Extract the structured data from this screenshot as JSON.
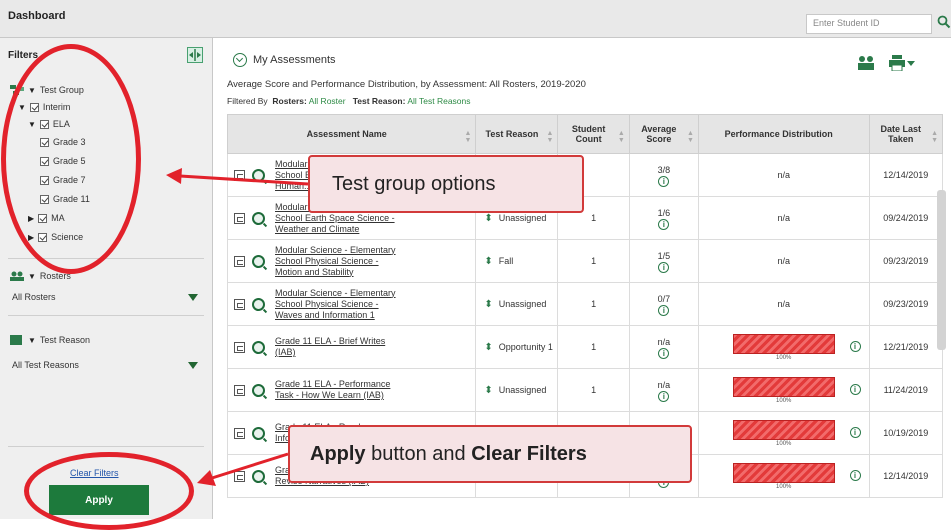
{
  "header": {
    "title": "Dashboard",
    "student_placeholder": "Enter Student ID"
  },
  "sidebar": {
    "filters_label": "Filters",
    "test_group_label": "Test Group",
    "tree": [
      {
        "label": "Interim",
        "level": 1,
        "expanded": true
      },
      {
        "label": "ELA",
        "level": 2,
        "expanded": true
      },
      {
        "label": "Grade 3",
        "level": 3
      },
      {
        "label": "Grade 5",
        "level": 3
      },
      {
        "label": "Grade 7",
        "level": 3
      },
      {
        "label": "Grade 11",
        "level": 3
      },
      {
        "label": "MA",
        "level": 2,
        "expanded": false
      },
      {
        "label": "Science",
        "level": 2,
        "expanded": false
      }
    ],
    "rosters_label": "Rosters",
    "rosters_value": "All Rosters",
    "test_reason_label": "Test Reason",
    "test_reason_value": "All Test Reasons",
    "clear_filters": "Clear Filters",
    "apply": "Apply"
  },
  "main": {
    "section_title": "My Assessments",
    "subtitle": "Average Score and Performance Distribution, by Assessment: All Rosters, 2019-2020",
    "filtered_by_prefix": "Filtered By",
    "rosters_key": "Rosters:",
    "rosters_val": "All Roster",
    "reason_key": "Test Reason:",
    "reason_val": "All Test Reasons"
  },
  "table": {
    "columns": [
      "Assessment Name",
      "Test Reason",
      "Student Count",
      "Average Score",
      "Performance Distribution",
      "Date Last Taken"
    ],
    "rows": [
      {
        "name": "Modular Science - Elementary School Earth Space Science - Human...",
        "reason": "",
        "count": "",
        "score": "3/8",
        "perf": "n/a",
        "date": "12/14/2019"
      },
      {
        "name": "Modular Science - Elementary School Earth Space Science - Weather and Climate",
        "reason": "Unassigned",
        "count": "1",
        "score": "1/6",
        "perf": "n/a",
        "date": "09/24/2019"
      },
      {
        "name": "Modular Science - Elementary School Physical Science - Motion and Stability",
        "reason": "Fall",
        "count": "1",
        "score": "1/5",
        "perf": "n/a",
        "date": "09/23/2019"
      },
      {
        "name": "Modular Science - Elementary School Physical Science - Waves and Information 1",
        "reason": "Unassigned",
        "count": "1",
        "score": "0/7",
        "perf": "n/a",
        "date": "09/23/2019"
      },
      {
        "name": "Grade 11 ELA - Brief Writes (IAB)",
        "reason": "Opportunity 1",
        "count": "1",
        "score": "n/a",
        "perf_pct": 100,
        "pct_label": "100%",
        "date": "12/21/2019"
      },
      {
        "name": "Grade 11 ELA - Performance Task - How We Learn (IAB)",
        "reason": "Unassigned",
        "count": "1",
        "score": "n/a",
        "perf_pct": 100,
        "pct_label": "100%",
        "date": "11/24/2019"
      },
      {
        "name": "Grade 11 ELA - Read Informational Texts (IAB)",
        "reason": "",
        "count": "",
        "score": "",
        "perf_pct": 100,
        "pct_label": "100%",
        "date": "10/19/2019"
      },
      {
        "name": "Grade 11 ELA - Write and Revise Narratives (IAB)",
        "reason": "Unassigned",
        "count": "1",
        "score": "n/a",
        "perf_pct": 100,
        "pct_label": "100%",
        "date": "12/14/2019"
      }
    ]
  },
  "callouts": {
    "test_group": "Test group options",
    "apply_bold1": "Apply",
    "apply_mid": " button and ",
    "apply_bold2": "Clear Filters"
  },
  "colors": {
    "accent": "#1d7a3c",
    "annotation": "#e2222b",
    "bar": "#e33a3a"
  }
}
